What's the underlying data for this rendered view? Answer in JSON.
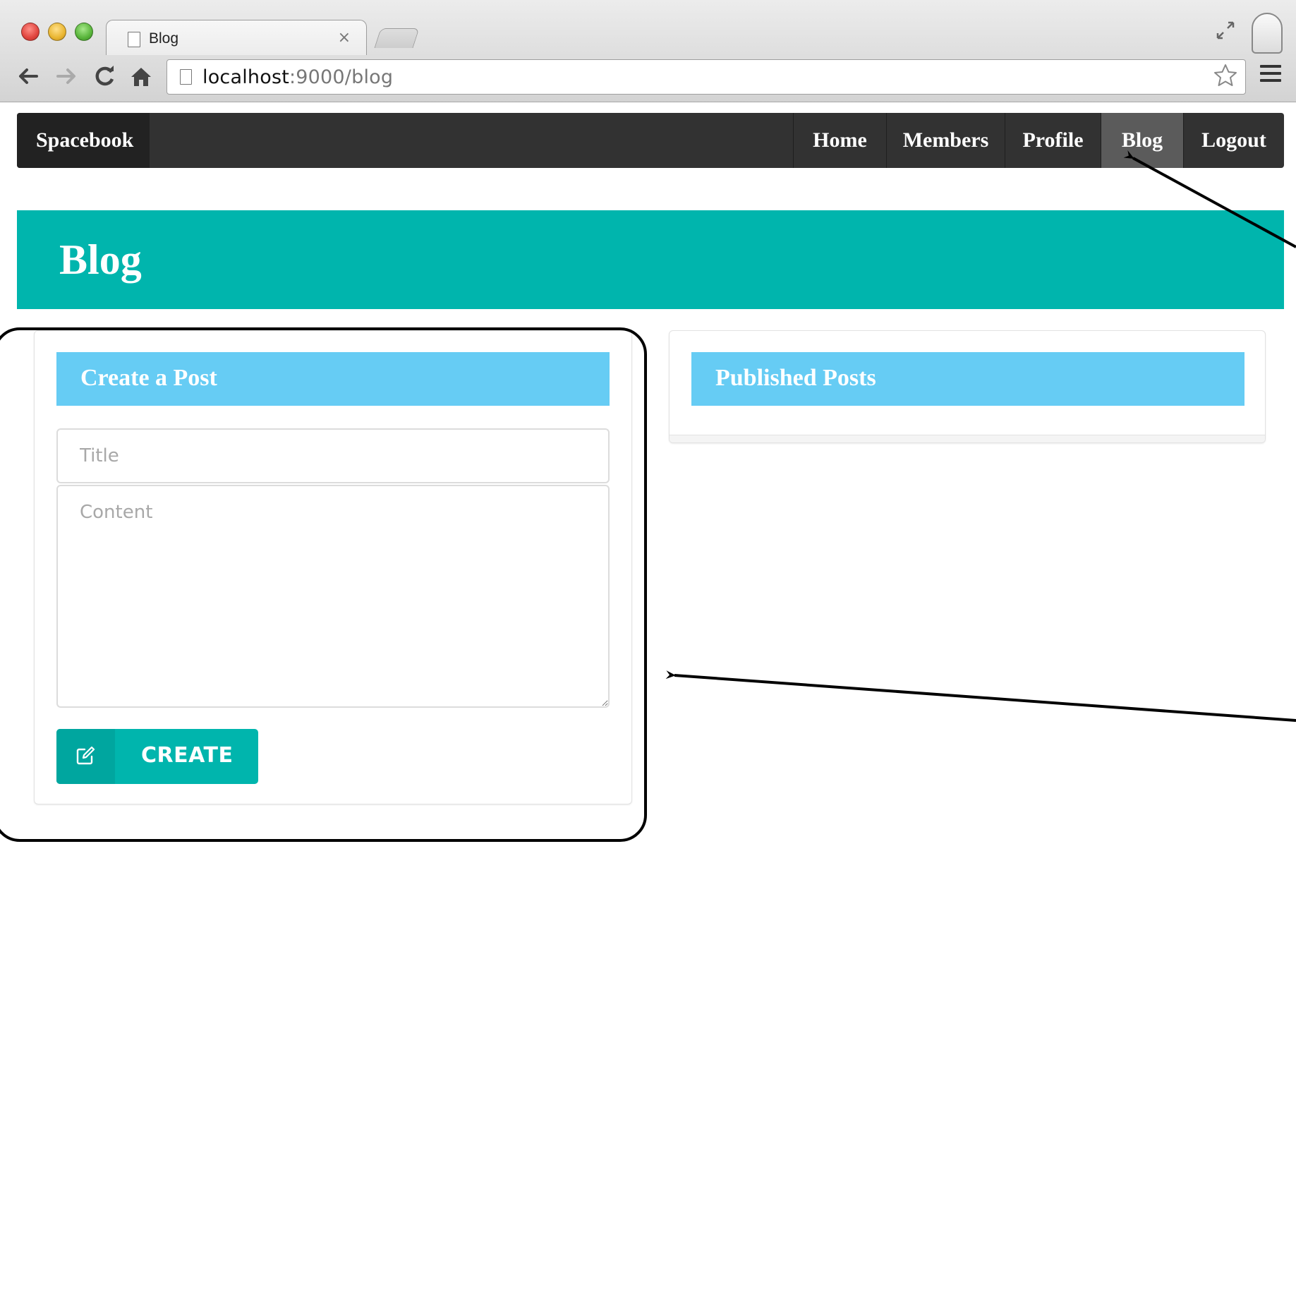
{
  "browser": {
    "tab_title": "Blog",
    "tab_close": "×",
    "url_host": "localhost",
    "url_rest": ":9000/blog",
    "icons": [
      "page-icon",
      "close-icon",
      "fullscreen-icon",
      "profile-icon",
      "back-arrow-icon",
      "forward-arrow-icon",
      "reload-icon",
      "home-icon",
      "star-icon",
      "menu-icon"
    ]
  },
  "navbar": {
    "brand": "Spacebook",
    "items": [
      {
        "label": "Home",
        "active": false
      },
      {
        "label": "Members",
        "active": false
      },
      {
        "label": "Profile",
        "active": false
      },
      {
        "label": "Blog",
        "active": true
      },
      {
        "label": "Logout",
        "active": false
      }
    ]
  },
  "page": {
    "title": "Blog"
  },
  "create_post": {
    "header": "Create a Post",
    "title_placeholder": "Title",
    "title_value": "",
    "content_placeholder": "Content",
    "content_value": "",
    "button_label": "CREATE",
    "button_icon": "edit-icon"
  },
  "published_posts": {
    "header": "Published Posts",
    "posts": []
  },
  "colors": {
    "navbar": "#323232",
    "navbar_active": "#5b5b5b",
    "accent_teal": "#00b5ad",
    "card_header_blue": "#66ccf4",
    "annotation": "#000000"
  }
}
